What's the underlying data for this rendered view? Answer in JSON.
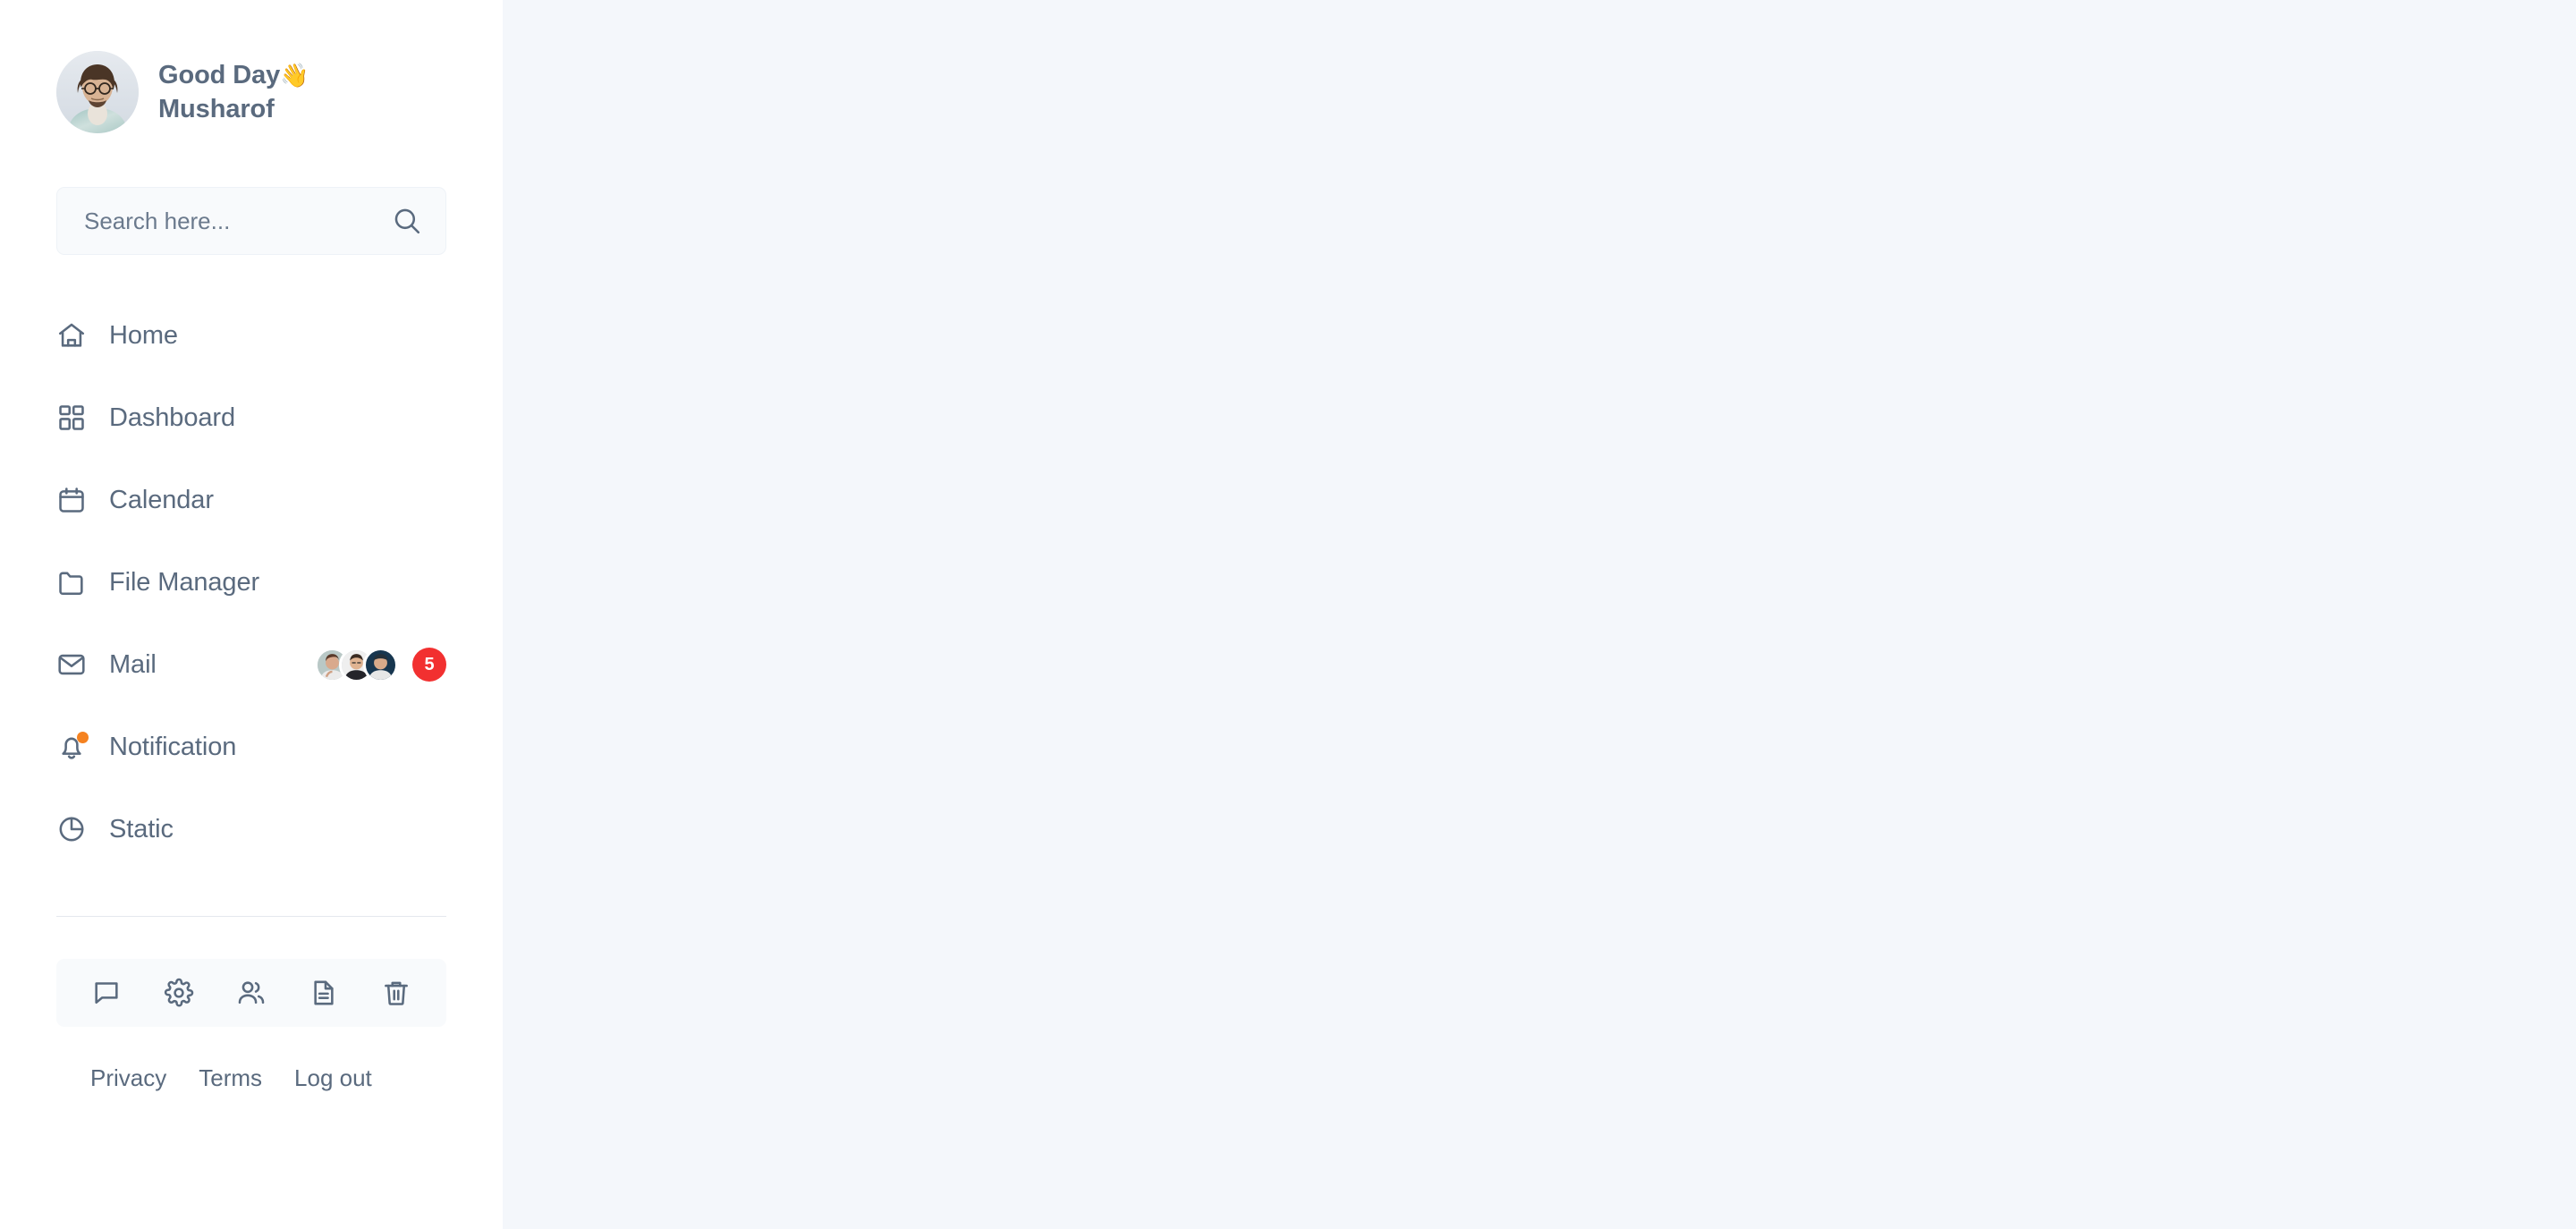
{
  "sidebar": {
    "profile": {
      "greeting_line1": "Good Day",
      "wave_emoji": "👋",
      "user_name": "Musharof",
      "avatar_icon": "user-photo-avatar"
    },
    "search": {
      "placeholder": "Search here...",
      "value": "",
      "icon": "search-icon"
    },
    "nav_items": [
      {
        "label": "Home",
        "icon": "home-icon"
      },
      {
        "label": "Dashboard",
        "icon": "grid-icon"
      },
      {
        "label": "Calendar",
        "icon": "calendar-icon"
      },
      {
        "label": "File Manager",
        "icon": "folder-icon"
      },
      {
        "label": "Mail",
        "icon": "mail-icon",
        "badge_count": "5",
        "avatar_count": 3
      },
      {
        "label": "Notification",
        "icon": "bell-icon",
        "has_dot": true
      },
      {
        "label": "Static",
        "icon": "pie-chart-icon"
      }
    ],
    "tool_icons": [
      {
        "name": "chat-icon"
      },
      {
        "name": "gear-icon"
      },
      {
        "name": "users-icon"
      },
      {
        "name": "document-icon"
      },
      {
        "name": "trash-icon"
      }
    ],
    "footer_links": [
      {
        "label": "Privacy"
      },
      {
        "label": "Terms"
      },
      {
        "label": "Log out"
      }
    ]
  },
  "colors": {
    "text": "#5a6a7e",
    "badge_red": "#f23030",
    "dot_orange": "#f58220",
    "main_bg": "#f4f7fb",
    "field_bg": "#f8fafc",
    "divider": "#e4e8ee"
  },
  "main": {
    "content": ""
  }
}
